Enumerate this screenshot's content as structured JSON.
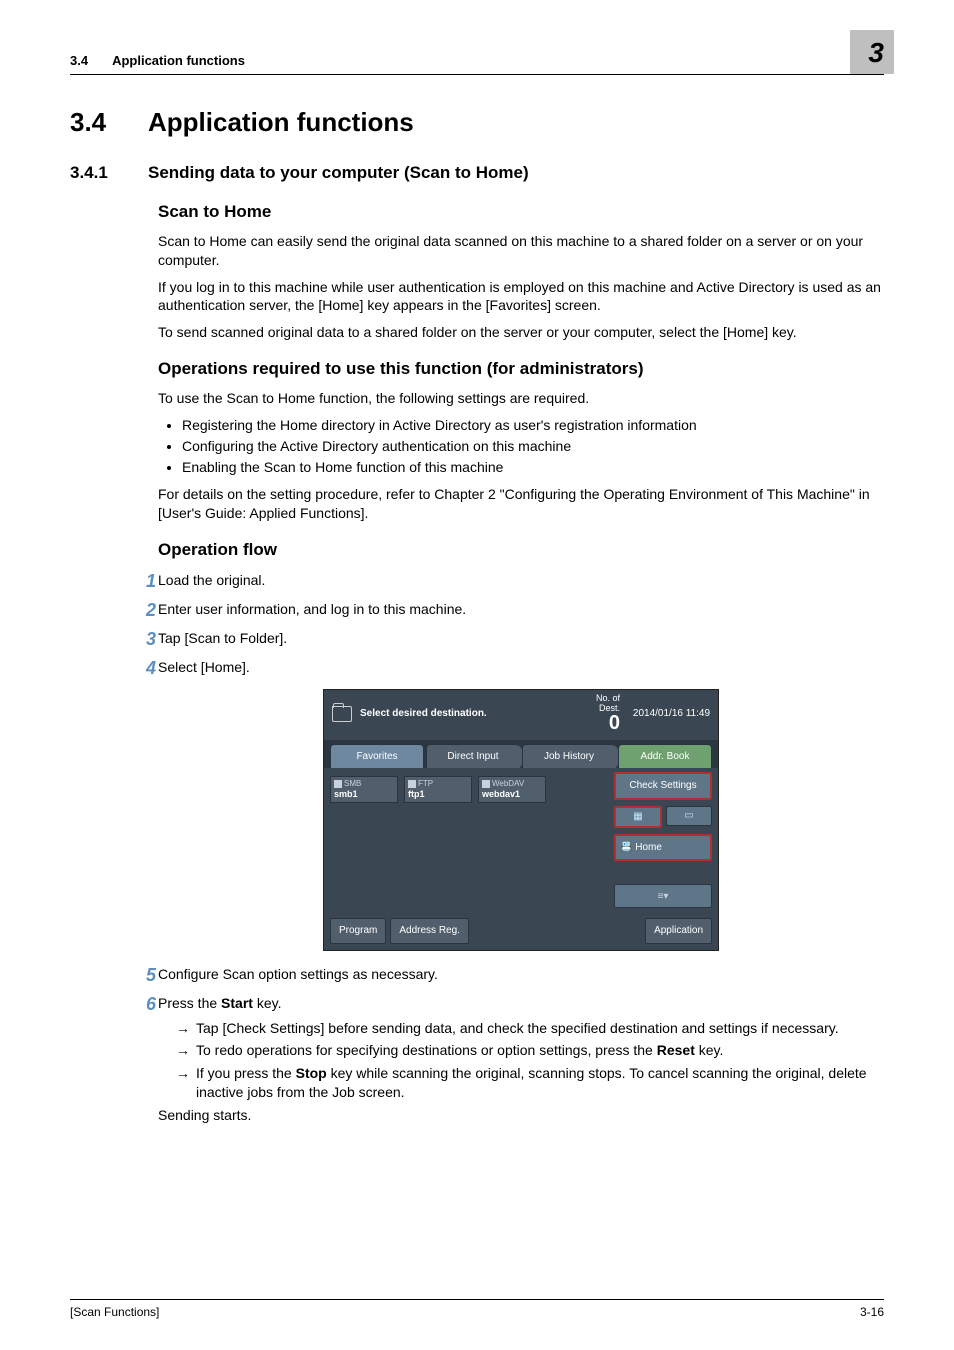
{
  "runhead": {
    "section_num": "3.4",
    "title": "Application functions",
    "chapter_number": "3"
  },
  "h1": {
    "num": "3.4",
    "title": "Application functions"
  },
  "h2": {
    "num": "3.4.1",
    "title": "Sending data to your computer (Scan to Home)"
  },
  "h3a": "Scan to Home",
  "p1": "Scan to Home can easily send the original data scanned on this machine to a shared folder on a server or on your computer.",
  "p2": "If you log in to this machine while user authentication is employed on this machine and Active Directory is used as an authentication server, the [Home] key appears in the [Favorites] screen.",
  "p3": "To send scanned original data to a shared folder on the server or your computer, select the [Home] key.",
  "h3b": "Operations required to use this function (for administrators)",
  "p4": "To use the Scan to Home function, the following settings are required.",
  "bullets": [
    "Registering the Home directory in Active Directory as user's registration information",
    "Configuring the Active Directory authentication on this machine",
    "Enabling the Scan to Home function of this machine"
  ],
  "p5": "For details on the setting procedure, refer to Chapter 2 \"Configuring the Operating Environment of This Machine\" in [User's Guide: Applied Functions].",
  "h3c": "Operation flow",
  "steps": [
    {
      "n": "1",
      "t": "Load the original."
    },
    {
      "n": "2",
      "t": "Enter user information, and log in to this machine."
    },
    {
      "n": "3",
      "t": "Tap [Scan to Folder]."
    },
    {
      "n": "4",
      "t": "Select [Home]."
    },
    {
      "n": "5",
      "t": "Configure Scan option settings as necessary."
    },
    {
      "n": "6",
      "t": "Press the Start key."
    }
  ],
  "arrows": [
    "Tap [Check Settings] before sending data, and check the specified destination and settings if necessary.",
    "To redo operations for specifying destinations or option settings, press the Reset key.",
    "If you press the Stop key while scanning the original, scanning stops. To cancel scanning the original, delete inactive jobs from the Job screen."
  ],
  "p6": "Sending starts.",
  "screenshot": {
    "msg": "Select desired destination.",
    "dest_label": "No. of\nDest.",
    "dest_count": "0",
    "datetime": "2014/01/16 11:49",
    "tabs": [
      "Favorites",
      "Direct Input",
      "Job History",
      "Addr. Book"
    ],
    "chips": [
      {
        "type": "SMB",
        "name": "smb1"
      },
      {
        "type": "FTP",
        "name": "ftp1"
      },
      {
        "type": "WebDAV",
        "name": "webdav1"
      }
    ],
    "check_settings": "Check Settings",
    "home_btn": "Home",
    "bottom": {
      "program": "Program",
      "address_reg": "Address Reg.",
      "application": "Application"
    }
  },
  "footer": {
    "left": "[Scan Functions]",
    "right": "3-16"
  }
}
